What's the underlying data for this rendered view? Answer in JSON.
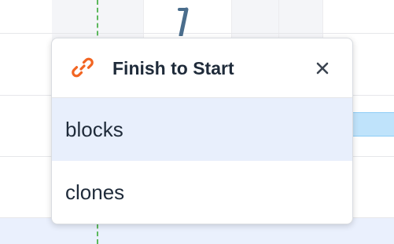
{
  "popup": {
    "title": "Finish to Start",
    "title_icon": "link-icon",
    "close_icon": "close-icon",
    "options": [
      {
        "label": "blocks",
        "selected": true
      },
      {
        "label": "clones",
        "selected": false
      }
    ]
  },
  "colors": {
    "link_icon": "#f26522",
    "selected_bg": "#e8effc",
    "today_line": "#5cb85c",
    "task_bar": "#bfe3fb",
    "dependency_line": "#4a6d8c"
  }
}
